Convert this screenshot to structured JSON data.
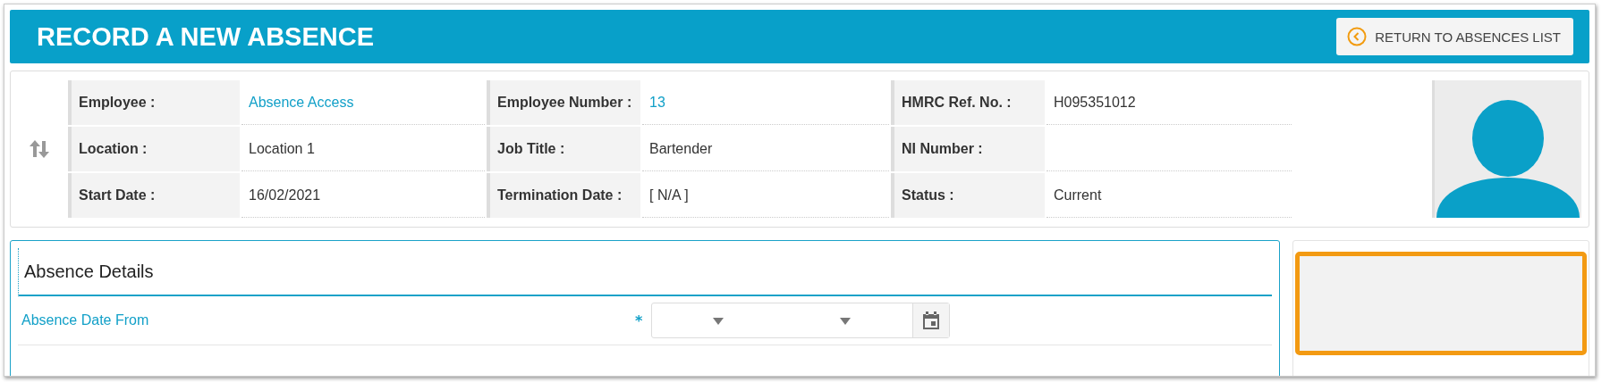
{
  "header": {
    "title": "RECORD A NEW ABSENCE",
    "return_button": "RETURN TO ABSENCES LIST"
  },
  "employee_info": {
    "rows": [
      [
        {
          "label": "Employee :",
          "value": "Absence Access",
          "kind": "link"
        },
        {
          "label": "Employee Number :",
          "value": "13",
          "kind": "link"
        },
        {
          "label": "HMRC Ref. No. :",
          "value": "H095351012",
          "kind": "text"
        }
      ],
      [
        {
          "label": "Location :",
          "value": "Location 1",
          "kind": "text"
        },
        {
          "label": "Job Title :",
          "value": "Bartender",
          "kind": "text"
        },
        {
          "label": "NI Number :",
          "kind": "text"
        }
      ],
      [
        {
          "label": "Start Date :",
          "value": "16/02/2021",
          "kind": "text"
        },
        {
          "label": "Termination Date :",
          "value": "[ N/A ]",
          "kind": "text"
        },
        {
          "label": "Status :",
          "value": "Current",
          "kind": "text"
        }
      ]
    ]
  },
  "absence_details": {
    "title": "Absence Details",
    "fields": [
      {
        "label": "Absence Date From",
        "required_mark": "*"
      }
    ]
  }
}
